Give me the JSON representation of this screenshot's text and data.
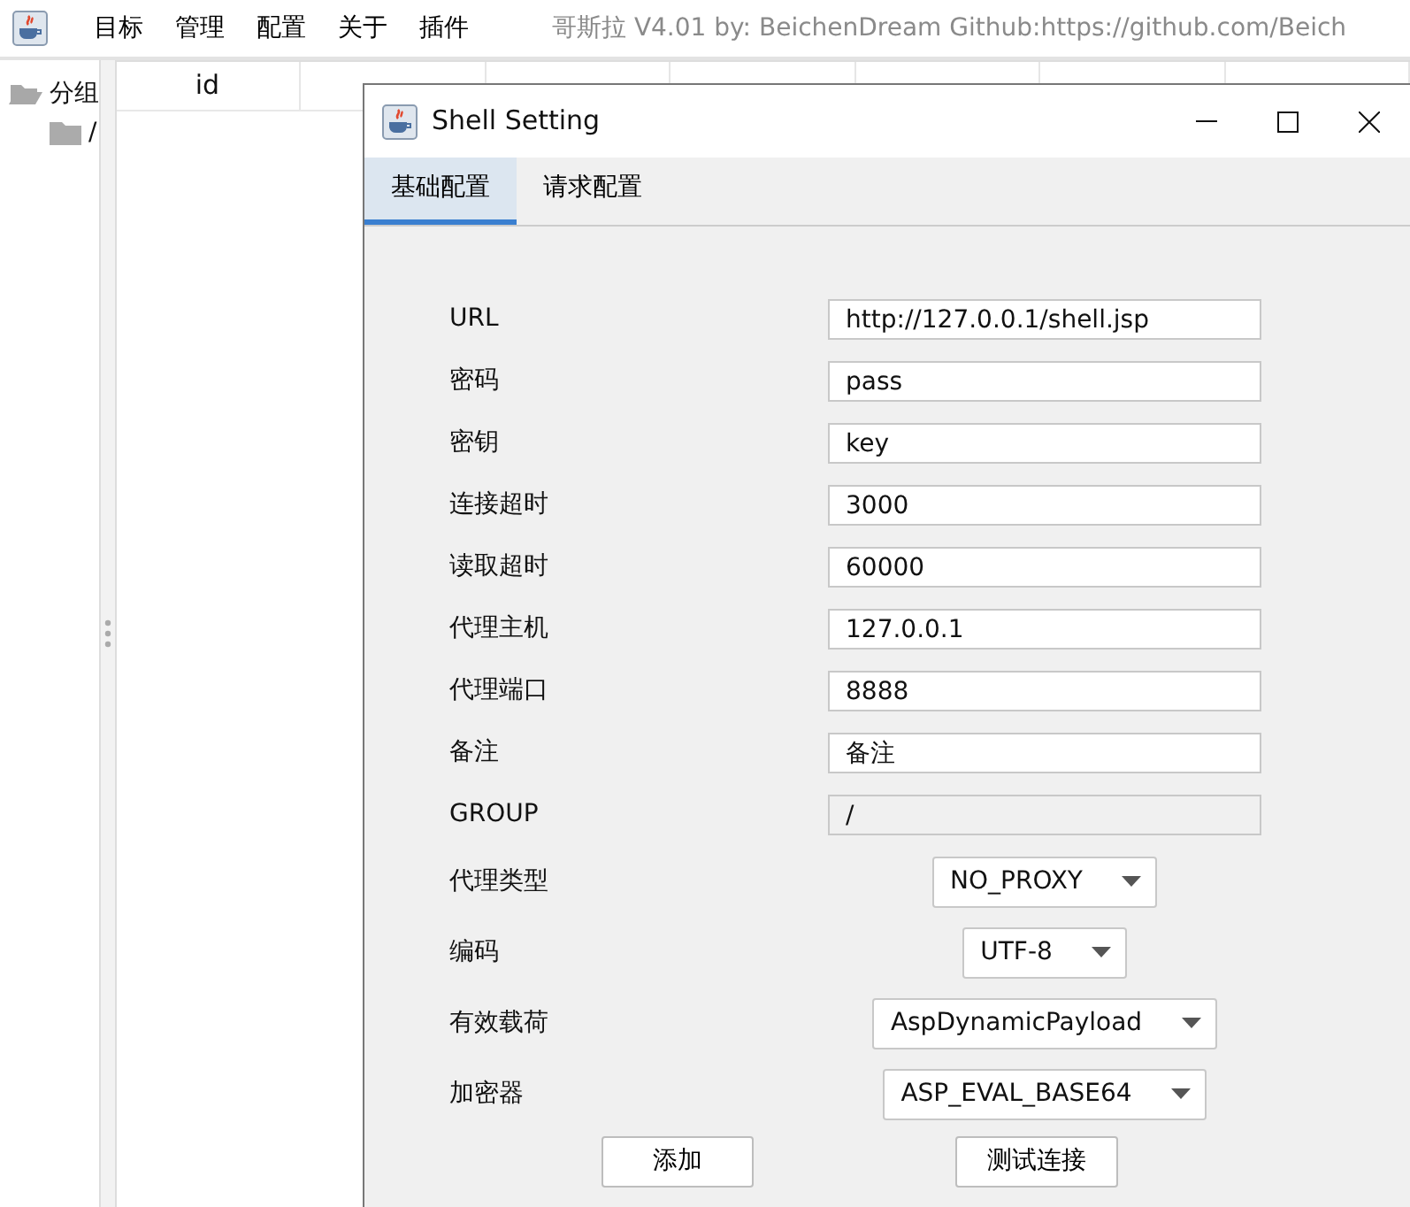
{
  "menu": [
    "目标",
    "管理",
    "配置",
    "关于",
    "插件"
  ],
  "app_info": "哥斯拉   V4.01 by: BeichenDream Github:https://github.com/Beich",
  "tree": [
    {
      "label": "分组",
      "expanded": true,
      "children": [
        {
          "label": "/",
          "expanded": false
        }
      ]
    }
  ],
  "table": {
    "columns": [
      "id"
    ]
  },
  "dialog": {
    "title": "Shell Setting",
    "tabs": [
      {
        "label": "基础配置",
        "selected": true
      },
      {
        "label": "请求配置",
        "selected": false
      }
    ],
    "fields": [
      {
        "kind": "text",
        "label": "URL",
        "value": "http://127.0.0.1/shell.jsp",
        "disabled": false
      },
      {
        "kind": "text",
        "label": "密码",
        "value": "pass",
        "disabled": false
      },
      {
        "kind": "text",
        "label": "密钥",
        "value": "key",
        "disabled": false
      },
      {
        "kind": "text",
        "label": "连接超时",
        "value": "3000",
        "disabled": false
      },
      {
        "kind": "text",
        "label": "读取超时",
        "value": "60000",
        "disabled": false
      },
      {
        "kind": "text",
        "label": "代理主机",
        "value": "127.0.0.1",
        "disabled": false
      },
      {
        "kind": "text",
        "label": "代理端口",
        "value": "8888",
        "disabled": false
      },
      {
        "kind": "text",
        "label": "备注",
        "value": "备注",
        "disabled": false
      },
      {
        "kind": "text",
        "label": "GROUP",
        "value": "/",
        "disabled": true
      },
      {
        "kind": "select",
        "label": "代理类型",
        "value": "NO_PROXY"
      },
      {
        "kind": "select",
        "label": "编码",
        "value": "UTF-8"
      },
      {
        "kind": "select",
        "label": "有效载荷",
        "value": "AspDynamicPayload"
      },
      {
        "kind": "select",
        "label": "加密器",
        "value": "ASP_EVAL_BASE64"
      }
    ],
    "buttons": [
      "添加",
      "测试连接"
    ]
  }
}
